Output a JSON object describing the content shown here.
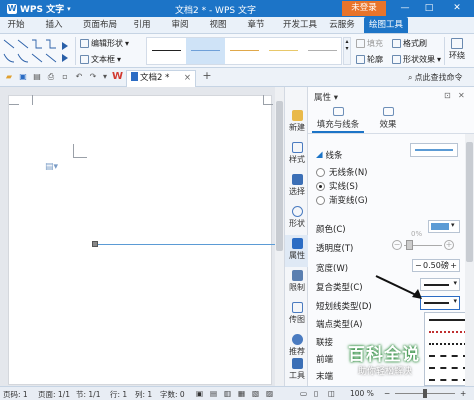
{
  "titlebar": {
    "app_name": "WPS 文字",
    "doc_title": "文档2 * - WPS 文字",
    "login_label": "未登录",
    "minimize": "—",
    "maximize": "□",
    "close": "✕"
  },
  "menu": {
    "tabs": [
      "开始",
      "插入",
      "页面布局",
      "引用",
      "审阅",
      "视图",
      "章节",
      "开发工具",
      "云服务",
      "绘图工具"
    ],
    "active": "绘图工具"
  },
  "ribbon": {
    "edit_shape_label": "编辑形状",
    "textbox_label": "文本框",
    "fill_label": "填充",
    "format_brush_label": "格式刷",
    "outline_label": "轮廓",
    "shape_effect_label": "形状效果",
    "wrap_label": "环绕"
  },
  "docbar": {
    "doc_tab_label": "文档2 *",
    "doc_tab_close": "×",
    "add_tab": "+",
    "search_label": "点此查找命令"
  },
  "sidebar": {
    "items": [
      "新建",
      "样式",
      "选择",
      "形状",
      "属性",
      "限制",
      "传图",
      "推荐",
      "工具"
    ]
  },
  "panel": {
    "title": "属性",
    "tab_fill_line": "填充与线条",
    "tab_effect": "效果",
    "section_line": "线条",
    "radio_no_line": "无线条(N)",
    "radio_solid": "实线(S)",
    "radio_gradient": "渐变线(G)",
    "color_label": "颜色(C)",
    "transparency_label": "透明度(T)",
    "transparency_value": "0%",
    "width_label": "宽度(W)",
    "width_value": "0.50磅",
    "compound_label": "复合类型(C)",
    "dash_label": "短划线类型(D)",
    "endpoint_label": "端点类型(A)",
    "join_label": "联接",
    "arrow_front_label": "前端",
    "arrow_end_label": "末端",
    "color_value": "#5b9bd5"
  },
  "watermark": {
    "line1": "百科全说",
    "line2": "助你轻松解决"
  },
  "status": {
    "page_num": "页码: 1",
    "pages": "页面: 1/1",
    "section": "节: 1/1",
    "line": "行: 1",
    "column": "列: 1",
    "words": "字数: 0",
    "zoom": "100 %"
  },
  "colors": {
    "accent": "#1c74c7",
    "login": "#e8742b",
    "line_color": "#5b9bd5"
  }
}
